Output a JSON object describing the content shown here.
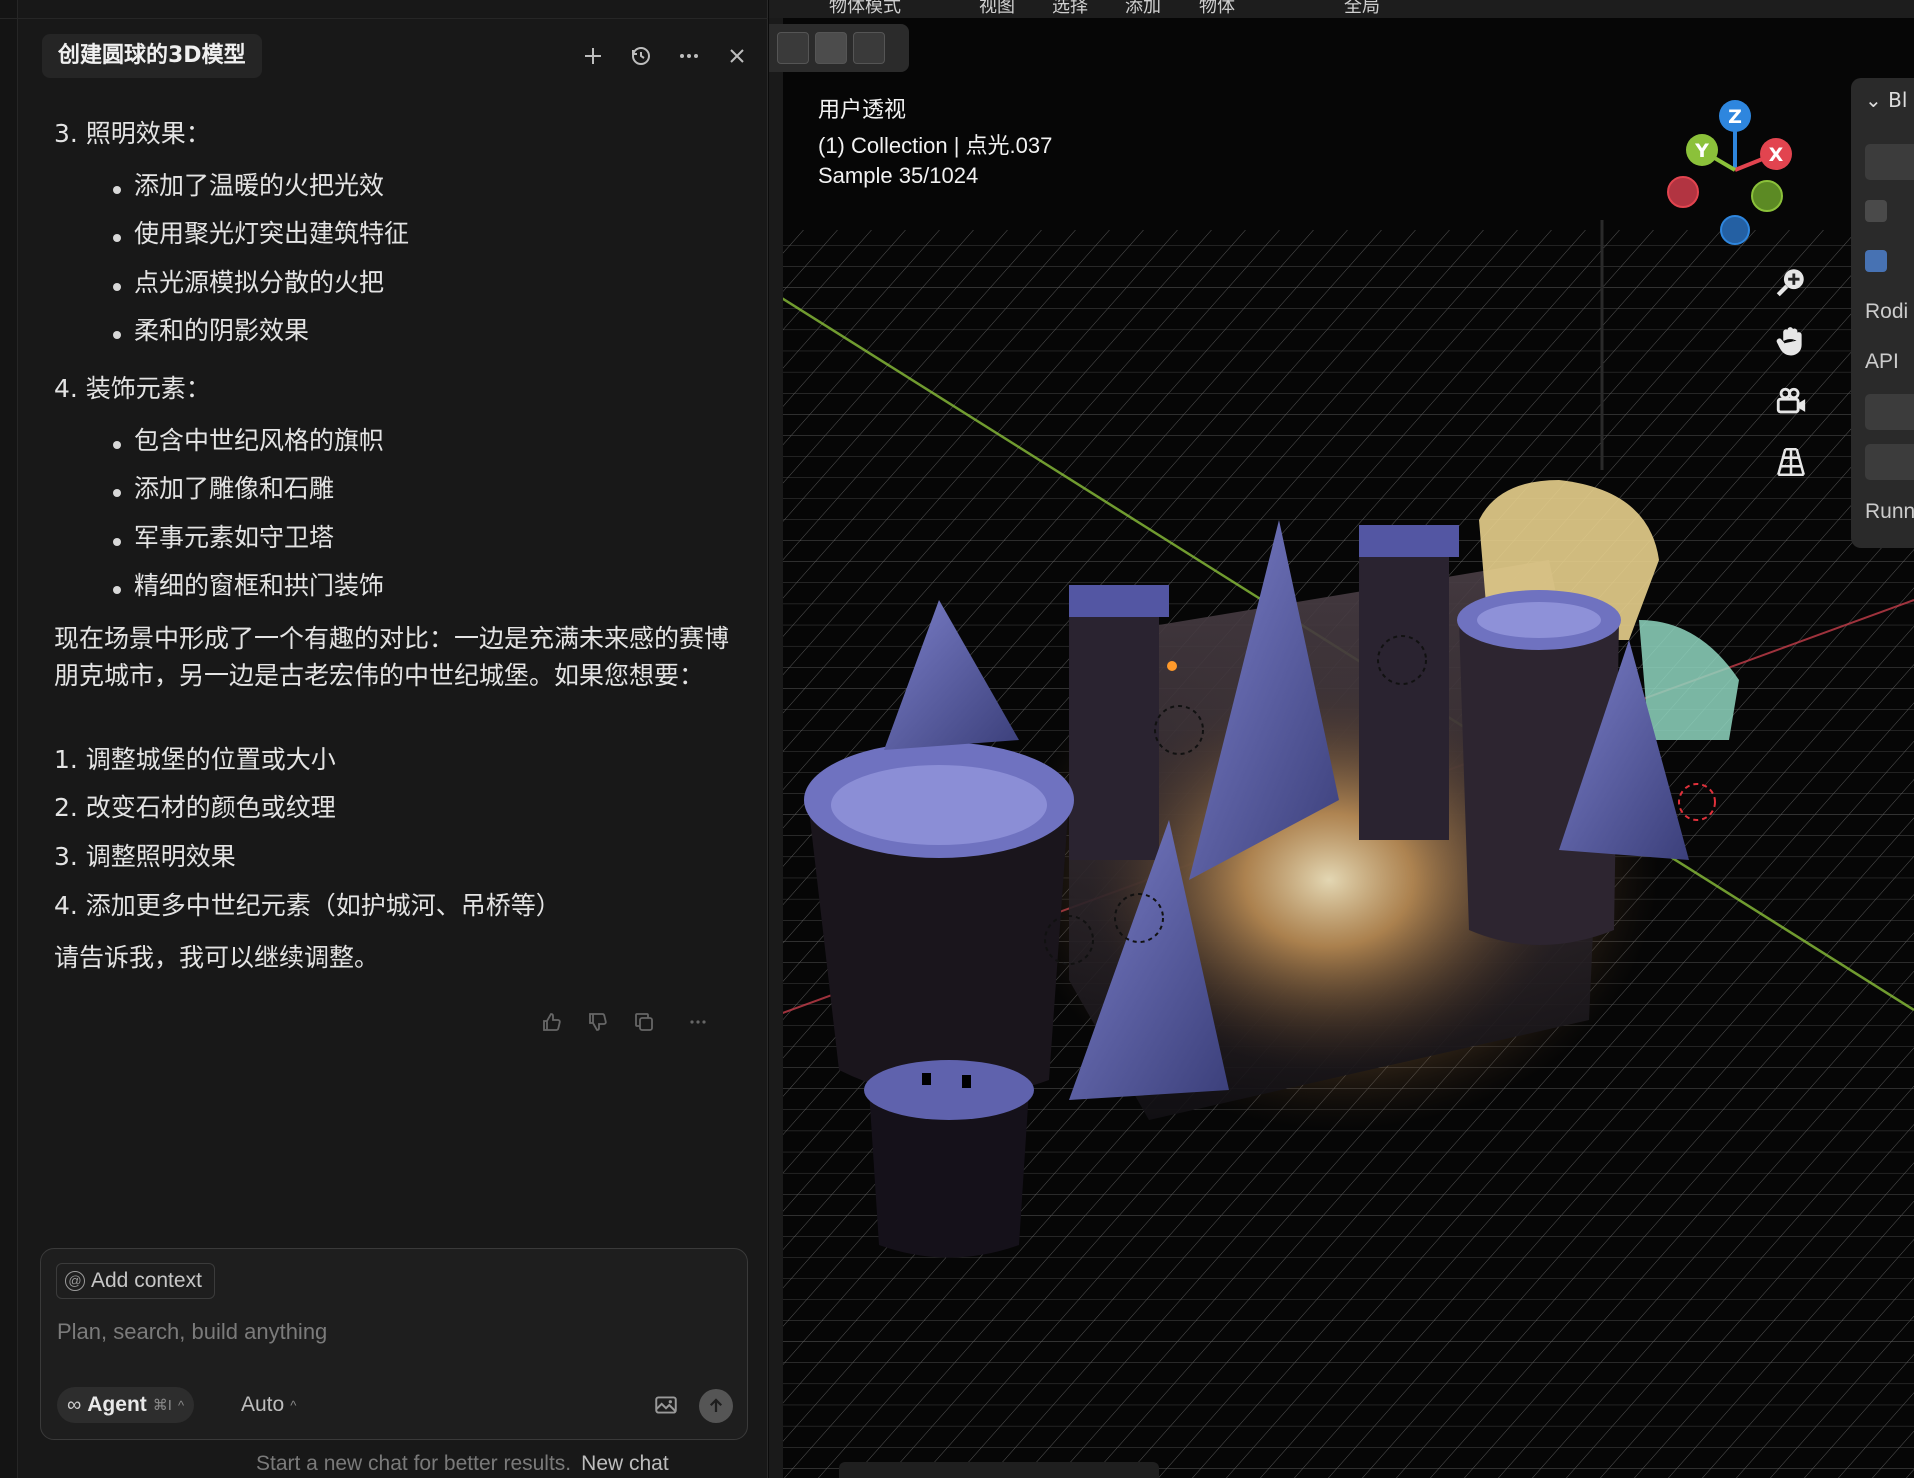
{
  "chat": {
    "title": "创建圆球的3D模型",
    "sections": [
      {
        "heading": "3. 照明效果：",
        "items": [
          "添加了温暖的火把光效",
          "使用聚光灯突出建筑特征",
          "点光源模拟分散的火把",
          "柔和的阴影效果"
        ]
      },
      {
        "heading": "4. 装饰元素：",
        "items": [
          "包含中世纪风格的旗帜",
          "添加了雕像和石雕",
          "军事元素如守卫塔",
          "精细的窗框和拱门装饰"
        ]
      }
    ],
    "summary": "现在场景中形成了一个有趣的对比：一边是充满未来感的赛博朋克城市，另一边是古老宏伟的中世纪城堡。如果您想要：",
    "options": [
      "1. 调整城堡的位置或大小",
      "2. 改变石材的颜色或纹理",
      "3. 调整照明效果",
      "4. 添加更多中世纪元素（如护城河、吊桥等）"
    ],
    "closing": "请告诉我，我可以继续调整。"
  },
  "composer": {
    "add_context": "Add context",
    "placeholder": "Plan, search, build anything",
    "agent_label": "Agent",
    "agent_shortcut": "⌘I",
    "model": "Auto",
    "hint": "Start a new chat for better results.",
    "new_chat": "New chat"
  },
  "viewport": {
    "view_name": "用户透视",
    "collection_line": "(1) Collection | 点光.037",
    "sample_line": "Sample 35/1024",
    "top_menu": [
      "物体模式",
      "视图",
      "选择",
      "添加",
      "物体",
      "全局"
    ],
    "gizmo": {
      "x": "X",
      "y": "Y",
      "z": "Z"
    },
    "n_panel": {
      "header": "Bl",
      "rows": [
        "Rodi",
        "API",
        "Runn"
      ]
    }
  },
  "colors": {
    "accent": "#4772b3",
    "axis_x": "#e2444f",
    "axis_y": "#8bc13a",
    "axis_z": "#2e86de"
  }
}
